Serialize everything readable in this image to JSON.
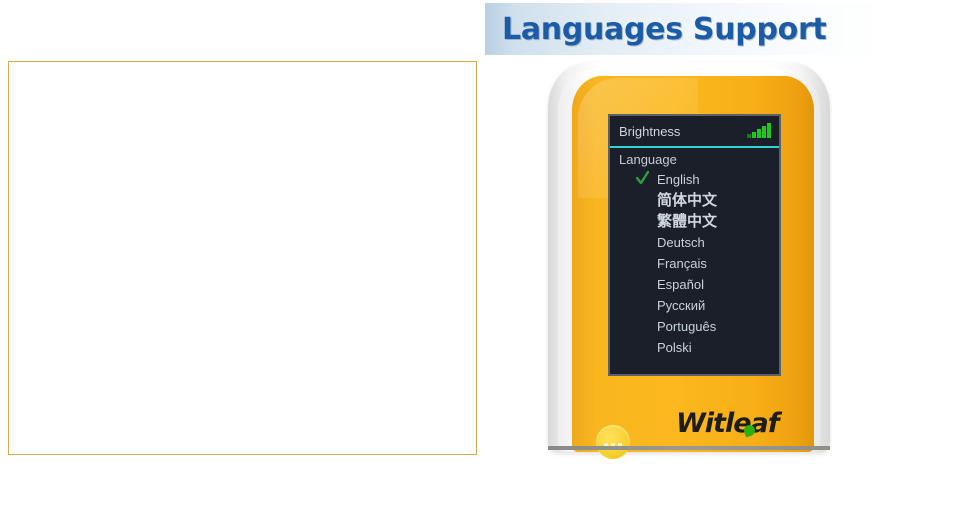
{
  "header": {
    "title": "Languages Support",
    "banner_gradient_start": "#b9cfe2",
    "banner_gradient_end": "#ffffff",
    "title_color": "#1c5ca6"
  },
  "left_panel": {
    "border_color": "#d4ab4c",
    "background_color": "#ffffff"
  },
  "device": {
    "shell_color": "#ffffff",
    "body_color": "#fcb81e",
    "brand": "Witleaf",
    "brand_leaf_color": "#2bb10f",
    "power_button_label": "",
    "screen": {
      "background_color": "#1b1f2a",
      "border_color": "#5d6168",
      "divider_color": "#2fd6d6",
      "status_title": "Brightness",
      "signal_icon": "signal-bars-icon",
      "signal_bars": 5,
      "signal_color": "#1ec81e",
      "menu_heading": "Language",
      "selected_index": 0,
      "check_icon": "check-icon",
      "check_color": "#2e9e3e",
      "text_color": "#c8d2db",
      "languages": [
        {
          "label": "English",
          "cjk": false,
          "selected": true
        },
        {
          "label": "简体中文",
          "cjk": true,
          "selected": false
        },
        {
          "label": "繁體中文",
          "cjk": true,
          "selected": false
        },
        {
          "label": "Deutsch",
          "cjk": false,
          "selected": false
        },
        {
          "label": "Français",
          "cjk": false,
          "selected": false
        },
        {
          "label": "Español",
          "cjk": false,
          "selected": false
        },
        {
          "label": "Русский",
          "cjk": false,
          "selected": false
        },
        {
          "label": "Português",
          "cjk": false,
          "selected": false
        },
        {
          "label": "Polski",
          "cjk": false,
          "selected": false
        }
      ]
    }
  }
}
